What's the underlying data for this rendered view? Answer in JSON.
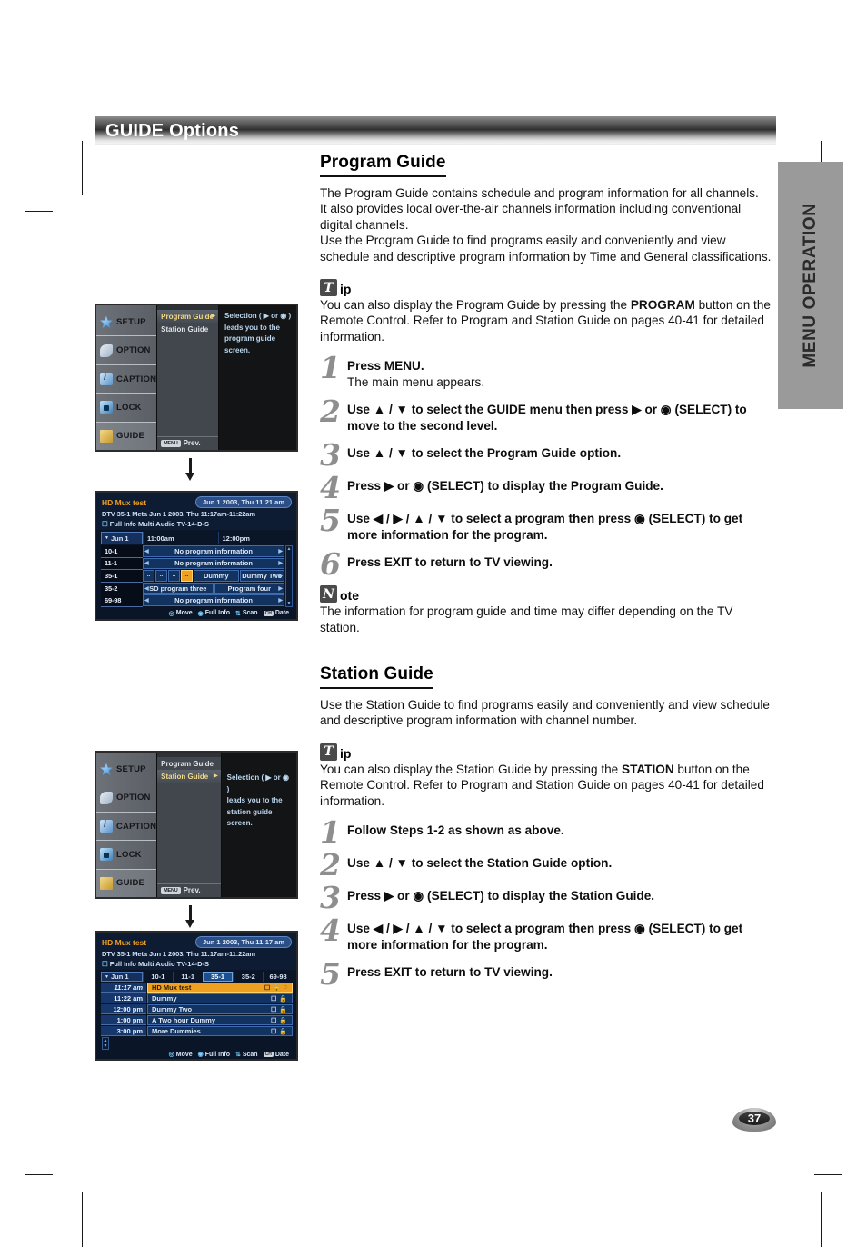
{
  "page": {
    "number": "37",
    "side_tab": "MENU OPERATION",
    "banner_title": "GUIDE Options"
  },
  "program_guide": {
    "heading": "Program Guide",
    "intro_lines": [
      "The Program Guide contains schedule and program information for all channels.",
      "It also provides local over-the-air channels information including conventional digital channels.",
      "Use the Program Guide to find programs easily and conveniently and view schedule and descriptive program information by Time and General classifications."
    ],
    "tip": {
      "badge": "T",
      "word": "ip",
      "text": "You can also display the Program Guide by pressing the PROGRAM button on the Remote Control. Refer to Program and Station Guide on pages 40-41 for detailed information.",
      "bold_term": "PROGRAM"
    },
    "steps": [
      {
        "num": "1",
        "main": "Press MENU.",
        "sub": "The main menu appears."
      },
      {
        "num": "2",
        "main": "Use ▲ / ▼ to select the GUIDE menu then press ▶ or ◉ (SELECT) to move to the second level.",
        "sub": ""
      },
      {
        "num": "3",
        "main": "Use ▲ / ▼ to select the Program Guide option.",
        "sub": ""
      },
      {
        "num": "4",
        "main": "Press ▶ or ◉ (SELECT) to display the Program Guide.",
        "sub": ""
      },
      {
        "num": "5",
        "main": "Use ◀ / ▶ / ▲ / ▼ to select a program then press ◉ (SELECT) to get more information for the program.",
        "sub": ""
      },
      {
        "num": "6",
        "main": "Press EXIT to return to TV viewing.",
        "sub": ""
      }
    ],
    "note": {
      "badge": "N",
      "word": "ote",
      "text": "The information for program guide and time may differ depending on the TV station."
    }
  },
  "station_guide": {
    "heading": "Station Guide",
    "intro": "Use the Station Guide to find programs easily and conveniently and view schedule and descriptive program information with channel number.",
    "tip": {
      "badge": "T",
      "word": "ip",
      "text": "You can also display the Station Guide by pressing the STATION button on the Remote Control. Refer to Program and Station Guide on pages 40-41 for detailed information.",
      "bold_term": "STATION"
    },
    "steps": [
      {
        "num": "1",
        "main": "Follow Steps 1-2 as shown as above.",
        "sub": ""
      },
      {
        "num": "2",
        "main": "Use ▲ / ▼ to select the Station Guide option.",
        "sub": ""
      },
      {
        "num": "3",
        "main": "Press ▶ or ◉ (SELECT) to display the Station Guide.",
        "sub": ""
      },
      {
        "num": "4",
        "main": "Use ◀ / ▶ / ▲ / ▼ to select a program then press ◉ (SELECT) to get more information for the program.",
        "sub": ""
      },
      {
        "num": "5",
        "main": "Press EXIT to return to TV viewing.",
        "sub": ""
      }
    ]
  },
  "osd_menu": {
    "sidebar": [
      {
        "label": "SETUP",
        "icon": "setup-icon"
      },
      {
        "label": "OPTION",
        "icon": "option-icon"
      },
      {
        "label": "CAPTION",
        "icon": "caption-icon"
      },
      {
        "label": "LOCK",
        "icon": "lock-icon"
      },
      {
        "label": "GUIDE",
        "icon": "guide-icon"
      }
    ],
    "items": [
      {
        "label": "Program Guide"
      },
      {
        "label": "Station Guide"
      }
    ],
    "prev_key": "MENU",
    "prev_label": "Prev.",
    "help_program": [
      "Selection ( ▶ or ◉ )",
      "leads you to the",
      "program guide screen."
    ],
    "help_station": [
      "Selection ( ▶ or ◉ )",
      "leads you to the",
      "station guide screen."
    ]
  },
  "osd_program_guide": {
    "title": "HD Mux test",
    "date_pill": "Jun 1 2003, Thu 11:21 am",
    "meta": "DTV 35-1 Meta Jun 1 2003, Thu  11:17am-11:22am",
    "flags": "Full Info  Multi Audio  TV-14-D-S",
    "date_button": "Jun 1",
    "time_slots": [
      "11:00am",
      "12:00pm"
    ],
    "channels": [
      "10-1",
      "11-1",
      "35-1",
      "35-2",
      "69-98"
    ],
    "rows": [
      {
        "channel": "10-1",
        "cells": [
          {
            "label": "No program information",
            "span": "wide"
          }
        ]
      },
      {
        "channel": "11-1",
        "cells": [
          {
            "label": "No program information",
            "span": "wide"
          }
        ]
      },
      {
        "channel": "35-1",
        "cells": [
          {
            "label": "..",
            "span": "tiny"
          },
          {
            "label": "..",
            "span": "tiny"
          },
          {
            "label": "..",
            "span": "tiny"
          },
          {
            "label": "..",
            "span": "tiny",
            "highlight": true
          },
          {
            "label": "Dummy",
            "span": "wide"
          },
          {
            "label": "Dummy Two",
            "span": "wide"
          }
        ]
      },
      {
        "channel": "35-2",
        "cells": [
          {
            "label": "SD program three",
            "span": "wide"
          },
          {
            "label": "Program four",
            "span": "wide"
          }
        ]
      },
      {
        "channel": "69-98",
        "cells": [
          {
            "label": "No program information",
            "span": "wide"
          }
        ]
      }
    ],
    "footer": [
      {
        "icon": "dpad-icon",
        "label": "Move"
      },
      {
        "icon": "select-icon",
        "label": "Full Info"
      },
      {
        "icon": "scan-icon",
        "label": "Scan"
      },
      {
        "icon": "date-key",
        "label": "Date"
      }
    ]
  },
  "osd_station_guide": {
    "title": "HD Mux test",
    "date_pill": "Jun 1 2003, Thu 11:17 am",
    "meta": "DTV 35-1 Meta Jun 1 2003, Thu  11:17am-11:22am",
    "flags": "Full Info  Multi Audio  TV-14-D-S",
    "date_button": "Jun 1",
    "channel_tabs": [
      "10-1",
      "11-1",
      "35-1",
      "35-2",
      "69-98"
    ],
    "selected_channel": "35-1",
    "rows": [
      {
        "time": "11:17 am",
        "program": "HD Mux test",
        "highlight": true,
        "icons": [
          "caption-icon",
          "lock-icon",
          "audio-icon"
        ]
      },
      {
        "time": "11:22 am",
        "program": "Dummy",
        "highlight": false,
        "icons": [
          "caption-icon",
          "lock-icon"
        ]
      },
      {
        "time": "12:00 pm",
        "program": "Dummy Two",
        "highlight": false,
        "icons": [
          "caption-icon",
          "lock-icon"
        ]
      },
      {
        "time": "1:00 pm",
        "program": "A Two hour Dummy",
        "highlight": false,
        "icons": [
          "caption-icon",
          "lock-icon"
        ]
      },
      {
        "time": "3:00 pm",
        "program": "More Dummies",
        "highlight": false,
        "icons": [
          "caption-icon",
          "lock-icon"
        ]
      }
    ],
    "footer": [
      {
        "icon": "dpad-icon",
        "label": "Move"
      },
      {
        "icon": "select-icon",
        "label": "Full Info"
      },
      {
        "icon": "scan-icon",
        "label": "Scan"
      },
      {
        "icon": "date-key",
        "label": "Date"
      }
    ]
  }
}
